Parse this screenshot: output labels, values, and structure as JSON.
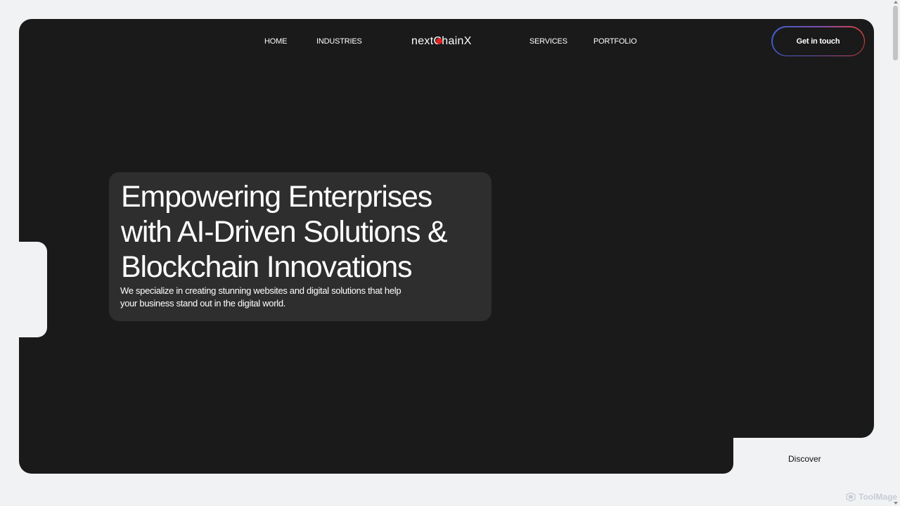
{
  "nav": {
    "home": "HOME",
    "industries": "INDUSTRIES",
    "services": "SERVICES",
    "portfolio": "PORTFOLIO"
  },
  "logo": {
    "text": "nextChainX",
    "accent_color": "#e02020"
  },
  "cta": {
    "label": "Get in touch"
  },
  "hero": {
    "title": "Empowering Enterprises with AI-Driven Solutions & Blockchain Innovations",
    "subtitle": "We specialize in creating stunning websites and digital solutions that help your business stand out in the digital world."
  },
  "discover": {
    "label": "Discover"
  },
  "watermark": {
    "text": "ToolMage"
  },
  "colors": {
    "panel": "#1a1a1b",
    "card": "#2e2e2e",
    "background": "#f1f2f4"
  }
}
